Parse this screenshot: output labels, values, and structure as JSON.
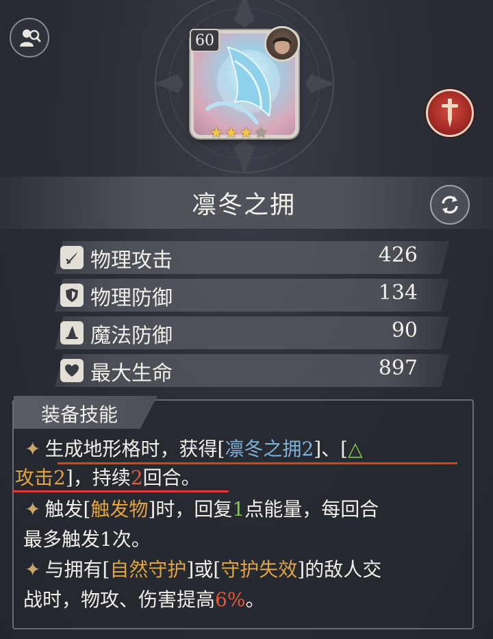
{
  "equipment": {
    "level": "60",
    "name": "凛冬之拥",
    "stars": [
      1,
      1,
      1,
      0
    ],
    "portrait_icon": "ice-blade-icon"
  },
  "stats": [
    {
      "icon": "sword-icon",
      "label": "物理攻击",
      "value": "426"
    },
    {
      "icon": "shield-icon",
      "label": "物理防御",
      "value": "134"
    },
    {
      "icon": "wizard-hat-icon",
      "label": "魔法防御",
      "value": "90"
    },
    {
      "icon": "heart-icon",
      "label": "最大生命",
      "value": "897"
    }
  ],
  "skills": {
    "title": "装备技能",
    "line1": {
      "a": "生成地形格时，获得[",
      "b": "凛冬之拥2",
      "c": "]、[",
      "d": "△"
    },
    "line2": {
      "a": "攻击2",
      "b": "]，持续",
      "c": "2",
      "d": "回合。"
    },
    "line3": {
      "a": "触发[",
      "b": "触发物",
      "c": "]时，回复",
      "d": "1",
      "e": "点能量，每回合"
    },
    "line4": "最多触发1次。",
    "line5": {
      "a": "与拥有[",
      "b": "自然守护",
      "c": "]或[",
      "d": "守护失效",
      "e": "]的敌人交"
    },
    "line6": {
      "a": "战时，物攻、伤害提高",
      "b": "6%",
      "c": "。"
    }
  },
  "colors": {
    "accent_blue": "#7fb1d9",
    "accent_green": "#7ecf48",
    "accent_gold": "#e0a443",
    "accent_red": "#e05b3e",
    "annotation_underline": "#e03a2a"
  }
}
